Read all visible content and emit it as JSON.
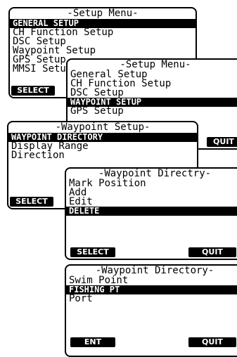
{
  "setup_menu_1": {
    "title": "-Setup Menu-",
    "items": [
      "GENERAL SETUP",
      "CH Function Setup",
      "DSC Setup",
      "Waypoint Setup",
      "GPS Setup",
      "MMSI Setup"
    ],
    "selected_index": 0,
    "softkey_left": "SELECT"
  },
  "setup_menu_2": {
    "title": "-Setup Menu-",
    "items": [
      "General Setup",
      "CH Function Setup",
      "DSC Setup",
      "WAYPOINT SETUP",
      "GPS Setup"
    ],
    "selected_index": 3,
    "softkey_right": "QUIT"
  },
  "waypoint_setup": {
    "title": "-Waypoint Setup-",
    "items": [
      "WAYPOINT DIRECTORY",
      "Display Range",
      "Direction"
    ],
    "selected_index": 0,
    "softkey_left": "SELECT"
  },
  "waypoint_directory_1": {
    "title": "-Waypoint Directry-",
    "items": [
      "Mark Position",
      "Add",
      "Edit",
      "DELETE"
    ],
    "selected_index": 3,
    "softkey_left": "SELECT",
    "softkey_right": "QUIT"
  },
  "waypoint_directory_2": {
    "title": "-Waypoint Directory-",
    "items": [
      "Swim Point",
      "FISHING PT",
      "Port"
    ],
    "selected_index": 1,
    "softkey_left": "ENT",
    "softkey_right": "QUIT"
  }
}
